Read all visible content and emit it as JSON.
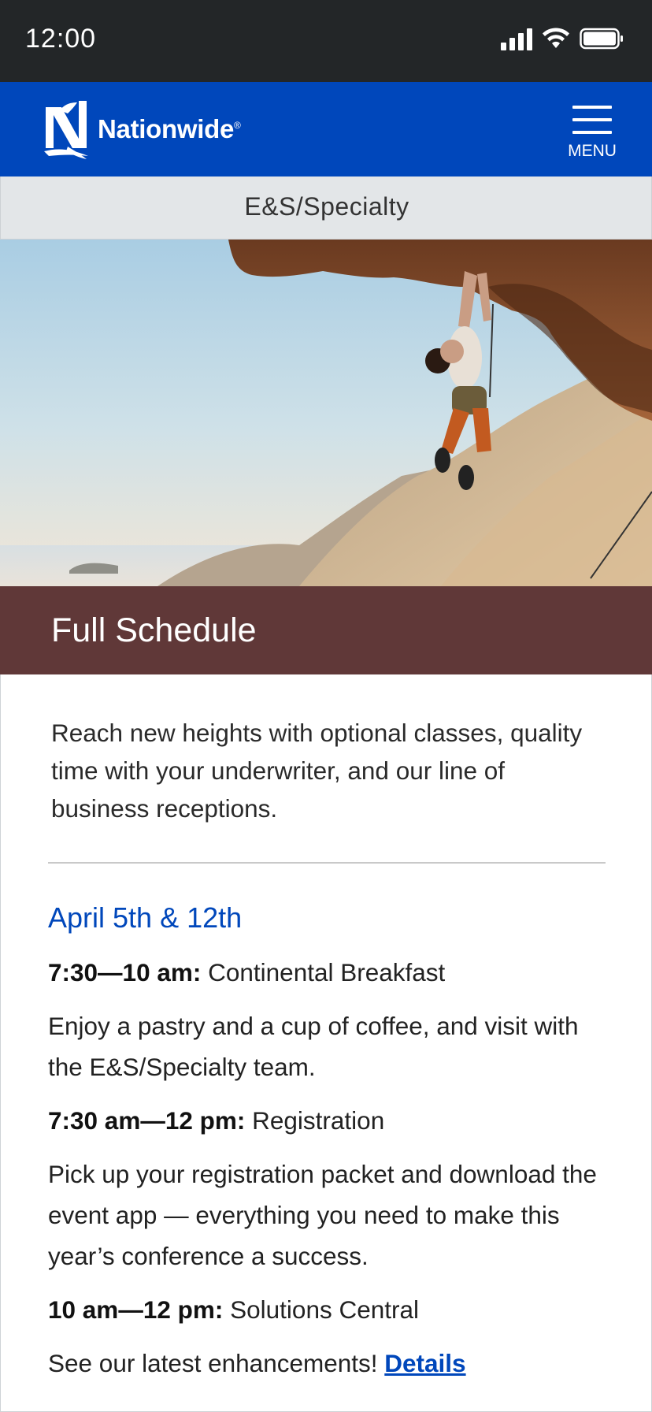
{
  "status_bar": {
    "time": "12:00",
    "icons": [
      "signal-icon",
      "wifi-icon",
      "battery-icon"
    ]
  },
  "navbar": {
    "brand": "Nationwide",
    "brand_mark": "®",
    "menu_label": "MENU",
    "background": "#0047bb"
  },
  "subnav": {
    "label": "E&S/Specialty"
  },
  "banner": {
    "title": "Full Schedule",
    "background": "#603838"
  },
  "content": {
    "intro": "Reach new heights with optional classes, quality time with your underwriter, and our line of business receptions.",
    "date_heading": "April 5th & 12th",
    "schedule": [
      {
        "time": "7:30—10 am:",
        "title": "Continental Breakfast",
        "description": "Enjoy a pastry and a cup of coffee, and visit with the E&S/Specialty team."
      },
      {
        "time": "7:30 am—12 pm:",
        "title": "Registration",
        "description": "Pick up your registration packet and download the event app — everything you need to make this year’s conference a success."
      },
      {
        "time": "10 am—12 pm:",
        "title": "Solutions Central",
        "description": "See our latest enhancements!",
        "link_label": "Details"
      }
    ]
  }
}
